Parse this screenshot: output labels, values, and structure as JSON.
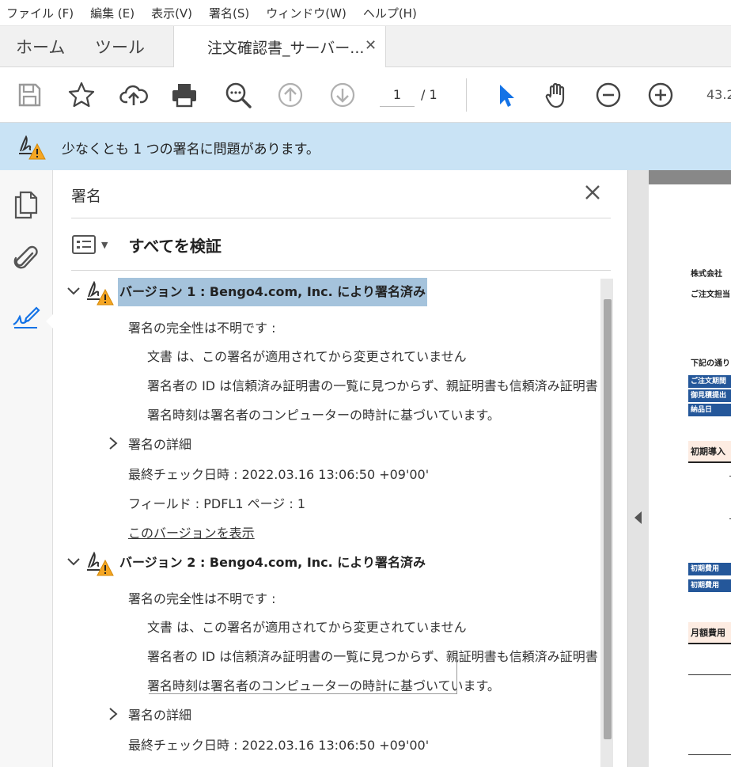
{
  "menu": [
    {
      "label": "ファイル (F)"
    },
    {
      "label": "編集 (E)"
    },
    {
      "label": "表示(V)"
    },
    {
      "label": "署名(S)"
    },
    {
      "label": "ウィンドウ(W)"
    },
    {
      "label": "ヘルプ(H)"
    }
  ],
  "tabs": {
    "home": "ホーム",
    "tools": "ツール",
    "document": "注文確認書_サーバー..."
  },
  "toolbar": {
    "page_current": "1",
    "page_total": "/ 1",
    "zoom": "43.2"
  },
  "banner": {
    "message": "少なくとも 1 つの署名に問題があります。"
  },
  "panel": {
    "title": "署名",
    "verify_all": "すべてを検証",
    "versions": [
      {
        "title": "バージョン 1 : Bengo4.com, Inc. により署名済み",
        "integrity": "署名の完全性は不明です :",
        "details_lines": [
          "文書 は、この署名が適用されてから変更されていません",
          "署名者の ID は信頼済み証明書の一覧に見つからず、親証明書も信頼済み証明書で",
          "署名時刻は署名者のコンピューターの時計に基づいています。"
        ],
        "sig_details": "署名の詳細",
        "last_checked": "最終チェック日時 : 2022.03.16 13:06:50 +09'00'",
        "field": "フィールド : PDFL1  ページ : 1",
        "view_version": "このバージョンを表示"
      },
      {
        "title": "バージョン 2 : Bengo4.com, Inc. により署名済み",
        "integrity": "署名の完全性は不明です :",
        "details_lines": [
          "文書 は、この署名が適用されてから変更されていません",
          "署名者の ID は信頼済み証明書の一覧に見つからず、親証明書も信頼済み証明書で",
          "署名時刻は署名者のコンピューターの時計に基づいています。"
        ],
        "sig_details": "署名の詳細",
        "last_checked": "最終チェック日時 : 2022.03.16 13:06:50 +09'00'"
      }
    ]
  },
  "document_preview": {
    "company": "株式会社",
    "contact": "ご注文担当",
    "notice": "下記の通り",
    "blue_rows_1": [
      "ご注文期間",
      "御見積提出",
      "納品日"
    ],
    "section_1": "初期導入",
    "blue_rows_2": [
      "初期費用",
      "初期費用"
    ],
    "section_2": "月額費用"
  },
  "colors": {
    "banner_bg": "#c9e3f5",
    "selection": "#a5c3dc",
    "accent_blue": "#1473e6",
    "warning": "#f5a623",
    "doc_blue": "#24579a"
  }
}
